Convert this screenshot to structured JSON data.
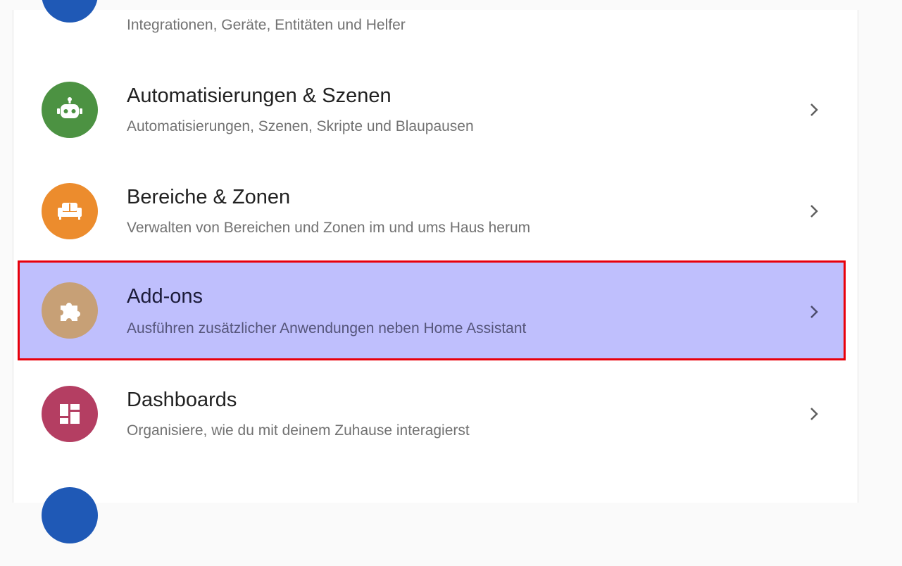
{
  "settings_list": [
    {
      "title": "",
      "subtitle": "Integrationen, Geräte, Entitäten und Helfer",
      "icon": "devices-icon",
      "color": "#1f59b6"
    },
    {
      "title": "Automatisierungen & Szenen",
      "subtitle": "Automatisierungen, Szenen, Skripte und Blaupausen",
      "icon": "robot-icon",
      "color": "#4c9242"
    },
    {
      "title": "Bereiche & Zonen",
      "subtitle": "Verwalten von Bereichen und Zonen im und ums Haus herum",
      "icon": "sofa-icon",
      "color": "#ec8c2d"
    },
    {
      "title": "Add-ons",
      "subtitle": "Ausführen zusätzlicher Anwendungen neben Home Assistant",
      "icon": "puzzle-icon",
      "color": "#c7a076",
      "highlighted": true
    },
    {
      "title": "Dashboards",
      "subtitle": "Organisiere, wie du mit deinem Zuhause interagierst",
      "icon": "dashboard-icon",
      "color": "#b43e62"
    },
    {
      "title": "",
      "subtitle": "",
      "icon": "partial-icon",
      "color": "#1f59b6"
    }
  ],
  "highlight_color": "#e8000b"
}
